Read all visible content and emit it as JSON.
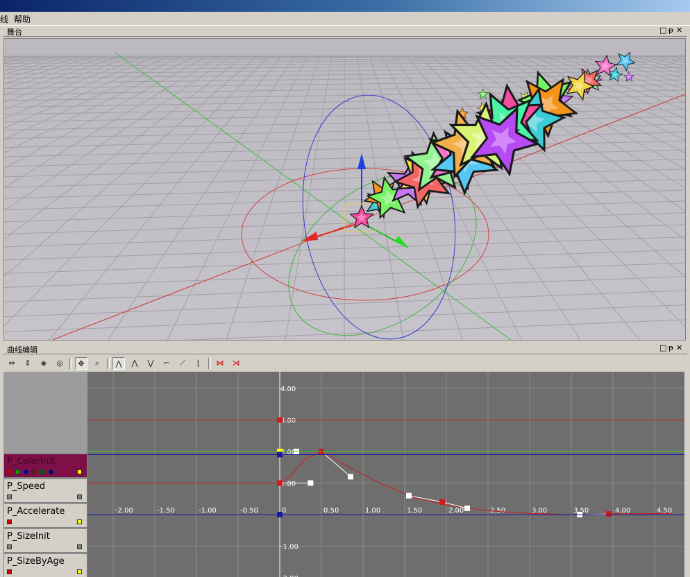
{
  "menu": {
    "item_partial": "线",
    "help": "帮助"
  },
  "stage_panel": {
    "title": "舞台",
    "btn_float": "□",
    "btn_pin": "ᵽ",
    "btn_close": "✕"
  },
  "curve_panel": {
    "title": "曲线编辑",
    "btn_float": "□",
    "btn_pin": "ᵽ",
    "btn_close": "✕"
  },
  "toolbar": {
    "icons": [
      "fit-horizontal-icon",
      "fit-vertical-icon",
      "fit-all-icon",
      "fit-selected-icon",
      "pan-icon",
      "zoom-icon",
      "curve-mode-1-icon",
      "curve-mode-2-icon",
      "curve-mode-3-icon",
      "curve-mode-4-icon",
      "linear-tangent-icon",
      "step-tangent-icon",
      "add-key-icon",
      "delete-key-icon"
    ]
  },
  "tracks": [
    {
      "label": "P_ColorInit",
      "selected": true,
      "chips": [
        "#cc0000",
        "#00aa00",
        "#0000cc",
        "#990000",
        "#006600",
        "#000088"
      ],
      "end_chip": "#ffff00"
    },
    {
      "label": "P_Speed",
      "selected": false,
      "chips": [
        "#808080"
      ],
      "end_chip": "#808080"
    },
    {
      "label": "P_Accelerate",
      "selected": false,
      "chips": [
        "#cc0000"
      ],
      "end_chip": "#ffff00"
    },
    {
      "label": "P_SizeInit",
      "selected": false,
      "chips": [
        "#808080"
      ],
      "end_chip": "#808080"
    },
    {
      "label": "P_SizeByAge",
      "selected": false,
      "chips": [
        "#cc0000"
      ],
      "end_chip": "#ffff00"
    }
  ],
  "graph": {
    "x_ticks": [
      "-2.00",
      "-1.50",
      "-1.00",
      "-0.50",
      "0",
      "0.50",
      "1.00",
      "1.50",
      "2.00",
      "2.50",
      "3.00",
      "3.50",
      "4.00",
      "4.50"
    ],
    "y_ticks": [
      "4.00",
      "3.00",
      "2.00",
      "1.00",
      "-1.00",
      "-2.00"
    ],
    "colors": {
      "red": "#d21a1a",
      "green": "#2fc82f",
      "blue": "#1a1aa0",
      "white": "#ffffff",
      "yellow": "#ffff00",
      "grid": "#8c8c8c",
      "bg": "#6e6e6e"
    }
  },
  "chart_data": {
    "type": "line",
    "x_range": [
      -2.0,
      4.6
    ],
    "y_range": [
      -2.0,
      4.4
    ],
    "grid": true,
    "series": [
      {
        "color": "#d21a1a",
        "curve": [
          [
            0,
            1.0
          ],
          [
            0.12,
            1.2
          ],
          [
            0.3,
            1.75
          ],
          [
            0.5,
            2.0
          ],
          [
            0.8,
            1.55
          ],
          [
            1.2,
            1.0
          ],
          [
            1.6,
            0.55
          ],
          [
            2.0,
            0.3
          ],
          [
            2.5,
            0.12
          ],
          [
            3.0,
            0.04
          ],
          [
            3.5,
            0.0
          ],
          [
            3.95,
            0.02
          ],
          [
            4.7,
            0.04
          ]
        ],
        "keys": [
          [
            0,
            1.0
          ],
          [
            0.5,
            2.0
          ],
          [
            1.95,
            0.4
          ],
          [
            3.95,
            0.02
          ]
        ],
        "tangents": [
          [
            0.37,
            1.0
          ],
          [
            0.2,
            2.0
          ],
          [
            0.85,
            1.2
          ],
          [
            1.55,
            0.6
          ],
          [
            2.25,
            0.2
          ],
          [
            3.6,
            0.0
          ]
        ]
      },
      {
        "color": "#d21a1a",
        "flat": 3.0,
        "keys": [
          [
            0,
            3.0
          ]
        ]
      },
      {
        "color": "#2fc82f",
        "flat": 2.0,
        "keys": [
          [
            0,
            2.0
          ]
        ]
      },
      {
        "color": "#1a1aa0",
        "flat": 1.9,
        "keys": [
          [
            0,
            1.9
          ]
        ]
      },
      {
        "color": "#1a1aa0",
        "flat": 0.0,
        "keys": [
          [
            0,
            0.0
          ]
        ]
      }
    ]
  }
}
